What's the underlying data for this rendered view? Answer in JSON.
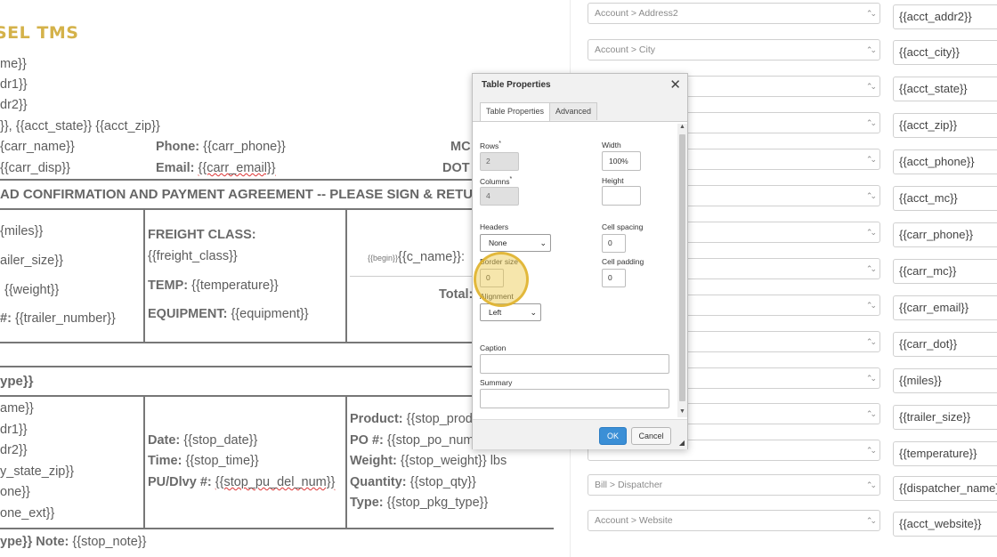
{
  "document": {
    "title": "SEL TMS",
    "lines": {
      "carr_name": "me}}",
      "addr1": "dr1}}",
      "addr2": "dr2}}",
      "city_state_zip": "}}, {{acct_state}} {{acct_zip}}",
      "carr_name_line": "{carr_name}}",
      "carr_disp_line": "{{carr_disp}}",
      "phone_label": "Phone:",
      "phone_value": "{{carr_phone}}",
      "email_label": "Email:",
      "email_value": "{{carr_email}}",
      "mc_label": "MC",
      "dot_label": "DOT",
      "agreement": "AD CONFIRMATION AND PAYMENT AGREEMENT -- PLEASE SIGN & RETURN",
      "miles": "{miles}}",
      "trailer_size": "ailer_size}}",
      "weight": "{{weight}}",
      "trailer_number_label": "#:",
      "trailer_number": "{{trailer_number}}",
      "freight_class_label": "FREIGHT CLASS:",
      "freight_class": "{{freight_class}}",
      "temp_label": "TEMP:",
      "temp_value": "{{temperature}}",
      "equipment_label": "EQUIPMENT:",
      "equipment_value": "{{equipment}}",
      "begin": "{{begin}}",
      "c_name": "{{c_name}}:",
      "total_label": "Total:",
      "type_heading": "ype}}",
      "stop_name": "ame}}",
      "stop_addr1": "dr1}}",
      "stop_addr2": "dr2}}",
      "stop_city_state_zip": "y_state_zip}}",
      "stop_phone": "one}}",
      "stop_phone_ext": "one_ext}}",
      "date_label": "Date:",
      "date_value": "{{stop_date}}",
      "time_label": "Time:",
      "time_value": "{{stop_time}}",
      "pudlvy_label": "PU/Dlvy #:",
      "pudlvy_value": "{{stop_pu_del_num}}",
      "product_label": "Product:",
      "product_value": "{{stop_prod",
      "po_label": "PO #:",
      "po_value": "{{stop_po_num",
      "weight_label": "Weight:",
      "weight_value": "{{stop_weight}} lbs",
      "qty_label": "Quantity:",
      "qty_value": "{{stop_qty}}",
      "type_label": "Type:",
      "type_value": "{{stop_pkg_type}}",
      "note_heading": "ype}} Note:",
      "note_value": "{{stop_note}}"
    }
  },
  "mapping": [
    {
      "select": "Account > Address2",
      "value": "{{acct_addr2}}"
    },
    {
      "select": "Account > City",
      "value": "{{acct_city}}"
    },
    {
      "select": "",
      "value": "{{acct_state}}"
    },
    {
      "select": "",
      "value": "{{acct_zip}}"
    },
    {
      "select": "",
      "value": "{{acct_phone}}"
    },
    {
      "select": "",
      "value": "{{acct_mc}}"
    },
    {
      "select": "",
      "value": "{{carr_phone}}"
    },
    {
      "select": "",
      "value": "{{carr_mc}}"
    },
    {
      "select": "",
      "value": "{{carr_email}}"
    },
    {
      "select": "",
      "value": "{{carr_dot}}"
    },
    {
      "select": "",
      "value": "{{miles}}"
    },
    {
      "select": "",
      "value": "{{trailer_size}}"
    },
    {
      "select": "",
      "value": "{{temperature}}"
    },
    {
      "select": "Bill > Dispatcher",
      "value": "{{dispatcher_name}}"
    },
    {
      "select": "Account > Website",
      "value": "{{acct_website}}"
    }
  ],
  "dialog": {
    "title": "Table Properties",
    "close_glyph": "✕",
    "tabs": [
      "Table Properties",
      "Advanced"
    ],
    "rows_label": "Rows",
    "rows_value": "2",
    "columns_label": "Columns",
    "columns_value": "4",
    "required_mark": "*",
    "width_label": "Width",
    "width_value": "100%",
    "height_label": "Height",
    "height_value": "",
    "headers_label": "Headers",
    "headers_value": "None",
    "cell_spacing_label": "Cell spacing",
    "cell_spacing_value": "0",
    "border_size_label": "Border size",
    "border_size_value": "0",
    "cell_padding_label": "Cell padding",
    "cell_padding_value": "0",
    "alignment_label": "Alignment",
    "alignment_value": "Left",
    "caption_label": "Caption",
    "caption_value": "",
    "summary_label": "Summary",
    "summary_value": "",
    "ok_label": "OK",
    "cancel_label": "Cancel"
  },
  "colors": {
    "accent": "#3b8fd6",
    "title_gold": "#d4b24a",
    "highlight": "#ecc846"
  }
}
